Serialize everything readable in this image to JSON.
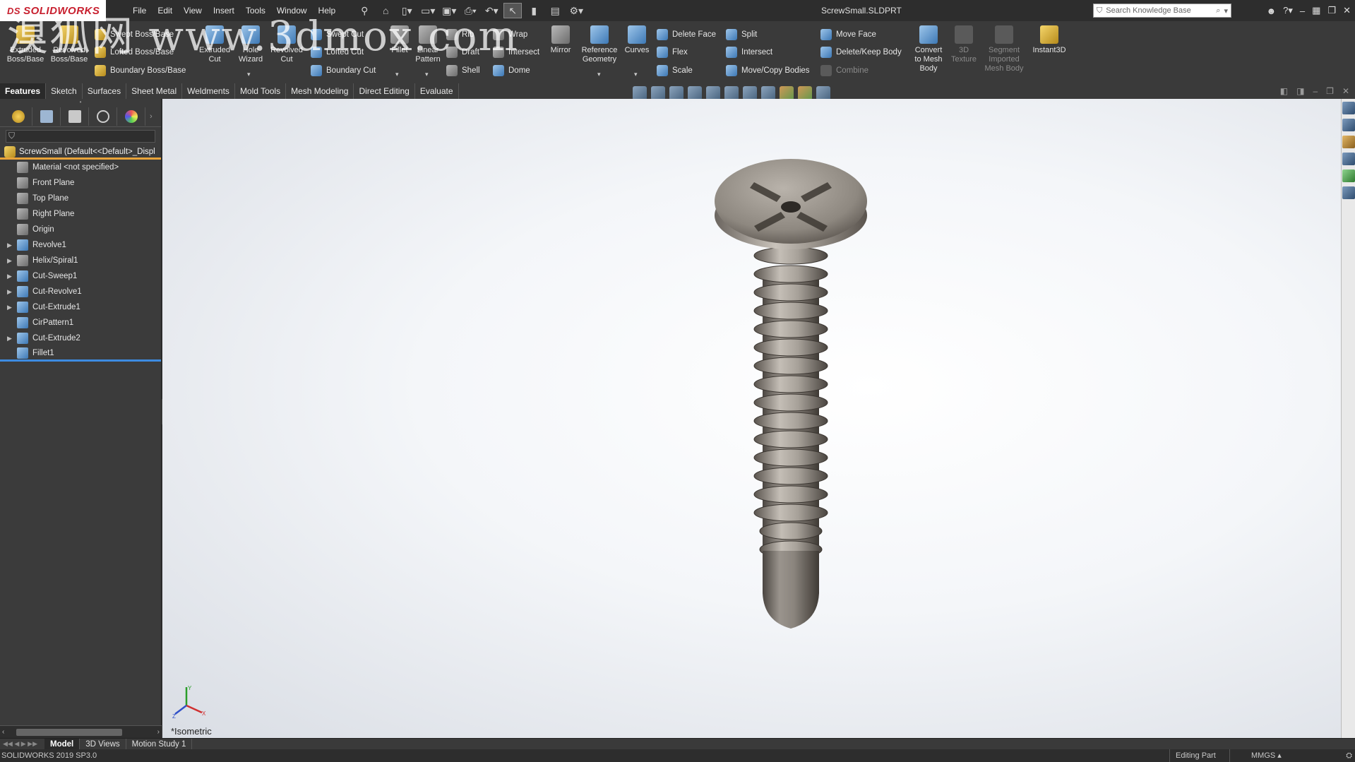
{
  "app": {
    "logo_text": "SOLIDWORKS",
    "logo_mark": "DS",
    "document_title": "ScrewSmall.SLDPRT"
  },
  "menu": [
    "File",
    "Edit",
    "View",
    "Insert",
    "Tools",
    "Window",
    "Help"
  ],
  "search": {
    "placeholder": "Search Knowledge Base"
  },
  "ribbon": {
    "extruded_boss": "Extruded Boss/Base",
    "revolved_boss": "Revolved Boss/Base",
    "swept_boss": "Swept Boss/Base",
    "lofted_boss": "Lofted Boss/Base",
    "boundary_boss": "Boundary Boss/Base",
    "extruded_cut": "Extruded Cut",
    "hole_wizard": "Hole Wizard",
    "revolved_cut": "Revolved Cut",
    "swept_cut": "Swept Cut",
    "lofted_cut": "Lofted Cut",
    "boundary_cut": "Boundary Cut",
    "fillet": "Fillet",
    "linear_pattern": "Linear Pattern",
    "rib": "Rib",
    "draft": "Draft",
    "shell": "Shell",
    "wrap": "Wrap",
    "intersect": "Intersect",
    "dome": "Dome",
    "mirror": "Mirror",
    "reference_geometry": "Reference Geometry",
    "curves": "Curves",
    "delete_face": "Delete Face",
    "flex": "Flex",
    "scale": "Scale",
    "split": "Split",
    "intersect2": "Intersect",
    "move_copy_bodies": "Move/Copy Bodies",
    "move_face": "Move Face",
    "delete_keep_body": "Delete/Keep Body",
    "combine": "Combine",
    "convert_to_mesh": "Convert to Mesh Body",
    "texture_3d": "3D Texture",
    "segment_mesh": "Segment Imported Mesh Body",
    "instant3d": "Instant3D"
  },
  "tabs": [
    "Features",
    "Sketch",
    "Surfaces",
    "Sheet Metal",
    "Weldments",
    "Mold Tools",
    "Mesh Modeling",
    "Direct Editing",
    "Evaluate"
  ],
  "tree": {
    "root": "ScrewSmall  (Default<<Default>_Displ",
    "items": [
      {
        "label": "Material <not specified>",
        "expandable": false
      },
      {
        "label": "Front Plane",
        "expandable": false
      },
      {
        "label": "Top Plane",
        "expandable": false
      },
      {
        "label": "Right Plane",
        "expandable": false
      },
      {
        "label": "Origin",
        "expandable": false
      },
      {
        "label": "Revolve1",
        "expandable": true
      },
      {
        "label": "Helix/Spiral1",
        "expandable": true
      },
      {
        "label": "Cut-Sweep1",
        "expandable": true
      },
      {
        "label": "Cut-Revolve1",
        "expandable": true
      },
      {
        "label": "Cut-Extrude1",
        "expandable": true
      },
      {
        "label": "CirPattern1",
        "expandable": false
      },
      {
        "label": "Cut-Extrude2",
        "expandable": true
      },
      {
        "label": "Fillet1",
        "expandable": false
      }
    ]
  },
  "viewport": {
    "view_label": "*Isometric"
  },
  "bottom_tabs": [
    "Model",
    "3D Views",
    "Motion Study 1"
  ],
  "status": {
    "version": "SOLIDWORKS 2019 SP3.0",
    "mode": "Editing Part",
    "units": "MMGS"
  },
  "watermark": "溴狐网 www.3dmox.com"
}
